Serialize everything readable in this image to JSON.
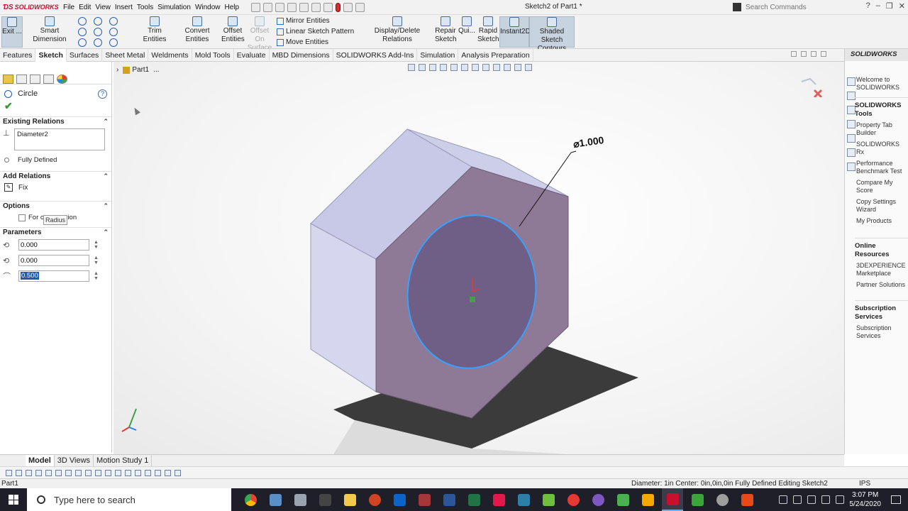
{
  "titlebar": {
    "app_logo": "SOLIDWORKS",
    "menus": [
      "File",
      "Edit",
      "View",
      "Insert",
      "Tools",
      "Simulation",
      "Window",
      "Help"
    ],
    "doc_title": "Sketch2 of Part1 *",
    "search_placeholder": "Search Commands"
  },
  "ribbon": {
    "exit": "Exit ...",
    "smart_dimension": "Smart Dimension",
    "trim": "Trim Entities",
    "convert": "Convert Entities",
    "offset_entities": "Offset Entities",
    "offset_on_surface": "Offset On Surface",
    "mirror": "Mirror Entities",
    "linear_pattern": "Linear Sketch Pattern",
    "move": "Move Entities",
    "display_delete": "Display/Delete Relations",
    "repair": "Repair Sketch",
    "quick": "Qui...",
    "rapid": "Rapid Sketch",
    "instant2d": "Instant2D",
    "shaded": "Shaded Sketch Contours"
  },
  "tabs": [
    "Features",
    "Sketch",
    "Surfaces",
    "Sheet Metal",
    "Weldments",
    "Mold Tools",
    "Evaluate",
    "MBD Dimensions",
    "SOLIDWORKS Add-Ins",
    "Simulation",
    "Analysis Preparation"
  ],
  "propmgr": {
    "title": "Circle",
    "existing_relations": "Existing Relations",
    "relation_item": "Diameter2",
    "status": "Fully Defined",
    "add_relations": "Add Relations",
    "fix": "Fix",
    "options": "Options",
    "for_construction": "For construction",
    "parameters": "Parameters",
    "cx": "0.000",
    "cy": "0.000",
    "radius": "0.500",
    "radius_tooltip": "Radius"
  },
  "graphics": {
    "tree_item": "Part1",
    "tree_more": "...",
    "dimension": "⌀1.000"
  },
  "taskpane": {
    "header": "SOLIDWORKS",
    "welcome": "Welcome to SOLIDWORKS",
    "tools_group": "SOLIDWORKS Tools",
    "tools": [
      "Property Tab Builder",
      "SOLIDWORKS Rx",
      "Performance Benchmark Test",
      "Compare My Score",
      "Copy Settings Wizard",
      "My Products"
    ],
    "online_group": "Online Resources",
    "online": [
      "3DEXPERIENCE Marketplace",
      "Partner Solutions"
    ],
    "subscription_group": "Subscription Services",
    "subscription": [
      "Subscription Services"
    ]
  },
  "bottom_tabs": [
    "Model",
    "3D Views",
    "Motion Study 1"
  ],
  "statusbar": {
    "left": "Part1",
    "right": "Diameter: 1in  Center: 0in,0in,0in Fully Defined  Editing Sketch2",
    "units": "IPS"
  },
  "taskbar": {
    "search": "Type here to search",
    "time": "3:07 PM",
    "date": "5/24/2020"
  },
  "colors": {
    "face_front": "#8e7a96",
    "face_top": "#c7c9e6",
    "face_side": "#d6d7ee",
    "circle_fill": "#6f5e85",
    "circle_stroke": "#3aa0ff",
    "shadow": "#3b3b3b"
  }
}
